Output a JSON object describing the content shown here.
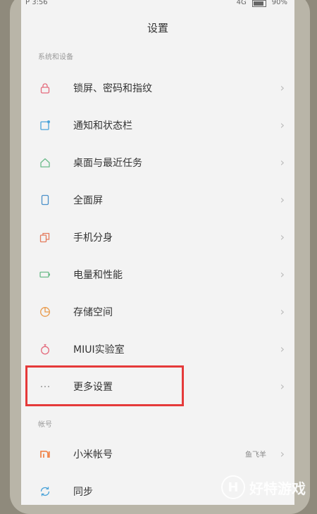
{
  "status": {
    "time": "P 3:56",
    "network": "4G",
    "battery": "90%"
  },
  "header": {
    "title": "设置"
  },
  "sections": [
    {
      "header": "系统和设备"
    },
    {
      "header": "帐号"
    }
  ],
  "items": [
    {
      "label": "锁屏、密码和指纹",
      "icon": "lock-icon",
      "color": "#e46a7c"
    },
    {
      "label": "通知和状态栏",
      "icon": "notification-icon",
      "color": "#4aa3d9"
    },
    {
      "label": "桌面与最近任务",
      "icon": "home-icon",
      "color": "#6bbb8a"
    },
    {
      "label": "全面屏",
      "icon": "fullscreen-icon",
      "color": "#4a90c9"
    },
    {
      "label": "手机分身",
      "icon": "dual-phone-icon",
      "color": "#e47a5c"
    },
    {
      "label": "电量和性能",
      "icon": "battery-icon",
      "color": "#6bbb8a"
    },
    {
      "label": "存储空间",
      "icon": "storage-icon",
      "color": "#e99a4a"
    },
    {
      "label": "MIUI实验室",
      "icon": "lab-flask-icon",
      "color": "#e46a7c"
    },
    {
      "label": "更多设置",
      "icon": "more-dots-icon",
      "color": "#999999"
    }
  ],
  "account_items": [
    {
      "label": "小米帐号",
      "value": "鱼飞羊",
      "icon": "mi-logo-icon",
      "color": "#f07a3a"
    },
    {
      "label": "同步",
      "icon": "sync-icon",
      "color": "#4aa3d9"
    }
  ],
  "chevron": "›",
  "watermark": {
    "badge": "H",
    "text": "好特游戏"
  }
}
